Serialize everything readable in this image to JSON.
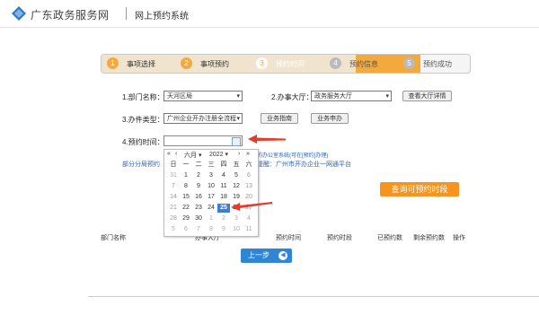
{
  "header": {
    "site_title": "广东政务服务网",
    "system_title": "网上预约系统"
  },
  "steps": [
    {
      "num": "1",
      "label": "事项选择"
    },
    {
      "num": "2",
      "label": "事项预约"
    },
    {
      "num": "3",
      "label": "预约时间"
    },
    {
      "num": "4",
      "label": "预约信息"
    },
    {
      "num": "5",
      "label": "预约成功"
    }
  ],
  "form": {
    "dept_label": "1.部门名称：",
    "dept_value": "天河区局",
    "hall_label": "2.办事大厅：",
    "hall_value": "政务服务大厅",
    "hall_detail_button": "查看大厅详情",
    "item_label": "3.办件类型：",
    "item_value": "广州企业开办注册全流程",
    "guide_button": "业务指南",
    "apply_button": "业务申办",
    "time_label": "4.预约时间：",
    "date_value": "",
    "notice_left": "部分分局预约",
    "notice_right_1": "的办公室系统(可在[预约]办理)",
    "notice_right_2": "提醒：广州市开办企业一网通平台",
    "query_button": "查询可预约时段"
  },
  "calendar": {
    "month": "六月",
    "year": "2022",
    "weekdays": [
      "日",
      "一",
      "二",
      "三",
      "四",
      "五",
      "六"
    ],
    "weeks": [
      [
        {
          "d": "31",
          "m": true
        },
        {
          "d": "1"
        },
        {
          "d": "2"
        },
        {
          "d": "3"
        },
        {
          "d": "4"
        },
        {
          "d": "5"
        },
        {
          "d": "6"
        }
      ],
      [
        {
          "d": "7"
        },
        {
          "d": "8"
        },
        {
          "d": "9"
        },
        {
          "d": "10"
        },
        {
          "d": "11"
        },
        {
          "d": "12"
        },
        {
          "d": "13"
        }
      ],
      [
        {
          "d": "14"
        },
        {
          "d": "15"
        },
        {
          "d": "16"
        },
        {
          "d": "17"
        },
        {
          "d": "18"
        },
        {
          "d": "19"
        },
        {
          "d": "20"
        }
      ],
      [
        {
          "d": "21"
        },
        {
          "d": "22"
        },
        {
          "d": "23"
        },
        {
          "d": "24"
        },
        {
          "d": "25",
          "s": true
        },
        {
          "d": "26"
        },
        {
          "d": "27"
        }
      ],
      [
        {
          "d": "28"
        },
        {
          "d": "29"
        },
        {
          "d": "30"
        },
        {
          "d": "1",
          "m": true
        },
        {
          "d": "2",
          "m": true
        },
        {
          "d": "3",
          "m": true
        },
        {
          "d": "4",
          "m": true
        }
      ],
      [
        {
          "d": "5",
          "m": true
        },
        {
          "d": "6",
          "m": true
        },
        {
          "d": "7",
          "m": true
        },
        {
          "d": "8",
          "m": true
        },
        {
          "d": "9",
          "m": true
        },
        {
          "d": "10",
          "m": true
        },
        {
          "d": "11",
          "m": true
        }
      ]
    ]
  },
  "table": {
    "headers": [
      "部门名称",
      "办事大厅",
      "预约时间",
      "预约时段",
      "已预约数",
      "剩余预约数",
      "操作"
    ]
  },
  "footer": {
    "prev_button": "上一步"
  },
  "colors": {
    "accent": "#f3a93b",
    "query": "#f7941d",
    "primary": "#2f86d4",
    "arrow": "#e33c2e"
  }
}
